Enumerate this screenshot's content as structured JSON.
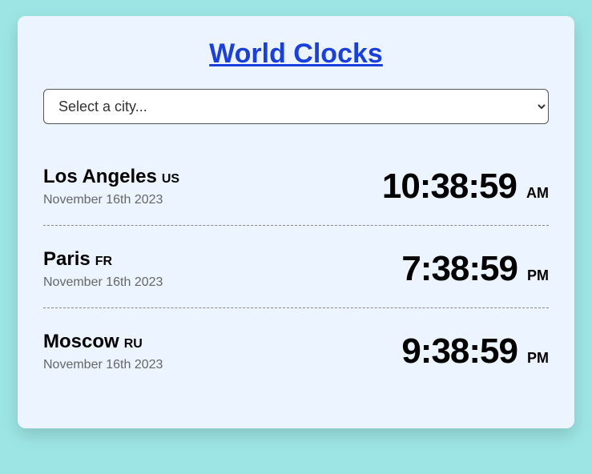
{
  "title": "World Clocks",
  "select": {
    "placeholder": "Select a city..."
  },
  "clocks": [
    {
      "city": "Los Angeles",
      "country": "US",
      "date": "November 16th 2023",
      "time": "10:38:59",
      "ampm": "AM"
    },
    {
      "city": "Paris",
      "country": "FR",
      "date": "November 16th 2023",
      "time": "7:38:59",
      "ampm": "PM"
    },
    {
      "city": "Moscow",
      "country": "RU",
      "date": "November 16th 2023",
      "time": "9:38:59",
      "ampm": "PM"
    }
  ]
}
